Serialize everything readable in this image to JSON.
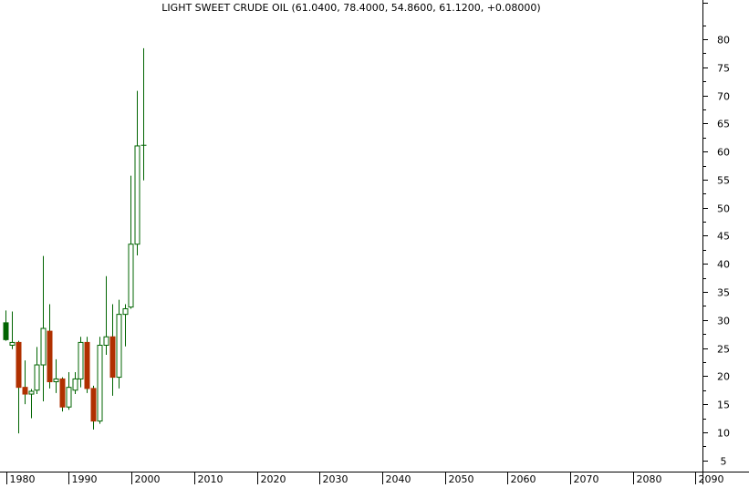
{
  "chart_data": {
    "type": "candlestick",
    "title": "LIGHT SWEET CRUDE OIL (61.0400, 78.4000, 54.8600, 61.1200, +0.08000)",
    "xlabel": "",
    "ylabel": "",
    "x_ticks": [
      "1980",
      "1990",
      "2000",
      "2010",
      "2020",
      "2030",
      "2040",
      "2050",
      "2060",
      "2070",
      "2080",
      "2090"
    ],
    "x_range": [
      1979.6,
      2089.8
    ],
    "y_ticks": [
      5,
      10,
      15,
      20,
      25,
      30,
      35,
      40,
      45,
      50,
      55,
      60,
      65,
      70,
      75,
      80
    ],
    "ylim": [
      0,
      88
    ],
    "grid": false,
    "axis_position": "right",
    "colors": {
      "up": "#006400",
      "down": "#b03000",
      "wick": "#006400",
      "axis": "#000000",
      "up_fill": "#ffffff",
      "down_fill": "#b03000",
      "first_fill": "#006400"
    },
    "candles": [
      {
        "x": 1979.9,
        "open": 26.5,
        "high": 31.7,
        "low": 26.3,
        "close": 29.5
      },
      {
        "x": 1980.9,
        "open": 25.5,
        "high": 31.5,
        "low": 24.8,
        "close": 26.0
      },
      {
        "x": 1981.9,
        "open": 26.0,
        "high": 26.3,
        "low": 9.8,
        "close": 18.0
      },
      {
        "x": 1982.9,
        "open": 18.0,
        "high": 22.8,
        "low": 15.0,
        "close": 16.8
      },
      {
        "x": 1983.9,
        "open": 16.8,
        "high": 17.7,
        "low": 12.5,
        "close": 17.3
      },
      {
        "x": 1984.9,
        "open": 17.5,
        "high": 25.2,
        "low": 16.8,
        "close": 22.0
      },
      {
        "x": 1985.9,
        "open": 22.0,
        "high": 41.4,
        "low": 15.5,
        "close": 28.5
      },
      {
        "x": 1986.9,
        "open": 28.0,
        "high": 32.8,
        "low": 17.8,
        "close": 19.0
      },
      {
        "x": 1987.9,
        "open": 19.0,
        "high": 23.0,
        "low": 17.0,
        "close": 19.5
      },
      {
        "x": 1988.9,
        "open": 19.5,
        "high": 19.8,
        "low": 13.7,
        "close": 14.5
      },
      {
        "x": 1989.9,
        "open": 14.5,
        "high": 20.7,
        "low": 14.0,
        "close": 18.0
      },
      {
        "x": 1990.9,
        "open": 17.5,
        "high": 20.7,
        "low": 16.8,
        "close": 19.5
      },
      {
        "x": 1991.9,
        "open": 19.5,
        "high": 27.0,
        "low": 18.0,
        "close": 26.0
      },
      {
        "x": 1992.9,
        "open": 26.0,
        "high": 27.0,
        "low": 17.0,
        "close": 17.8
      },
      {
        "x": 1993.9,
        "open": 17.8,
        "high": 18.3,
        "low": 10.5,
        "close": 12.0
      },
      {
        "x": 1994.9,
        "open": 12.0,
        "high": 27.0,
        "low": 11.5,
        "close": 25.5
      },
      {
        "x": 1995.9,
        "open": 25.5,
        "high": 37.8,
        "low": 23.8,
        "close": 27.0
      },
      {
        "x": 1996.9,
        "open": 27.0,
        "high": 32.8,
        "low": 16.5,
        "close": 19.8
      },
      {
        "x": 1997.9,
        "open": 19.8,
        "high": 33.6,
        "low": 17.8,
        "close": 31.0
      },
      {
        "x": 1998.9,
        "open": 31.0,
        "high": 32.8,
        "low": 25.3,
        "close": 32.0
      },
      {
        "x": 1999.9,
        "open": 32.3,
        "high": 55.7,
        "low": 32.0,
        "close": 43.5
      },
      {
        "x": 2000.9,
        "open": 43.5,
        "high": 70.8,
        "low": 41.5,
        "close": 61.0
      },
      {
        "x": 2001.9,
        "open": 61.04,
        "high": 78.4,
        "low": 54.86,
        "close": 61.12
      }
    ]
  }
}
